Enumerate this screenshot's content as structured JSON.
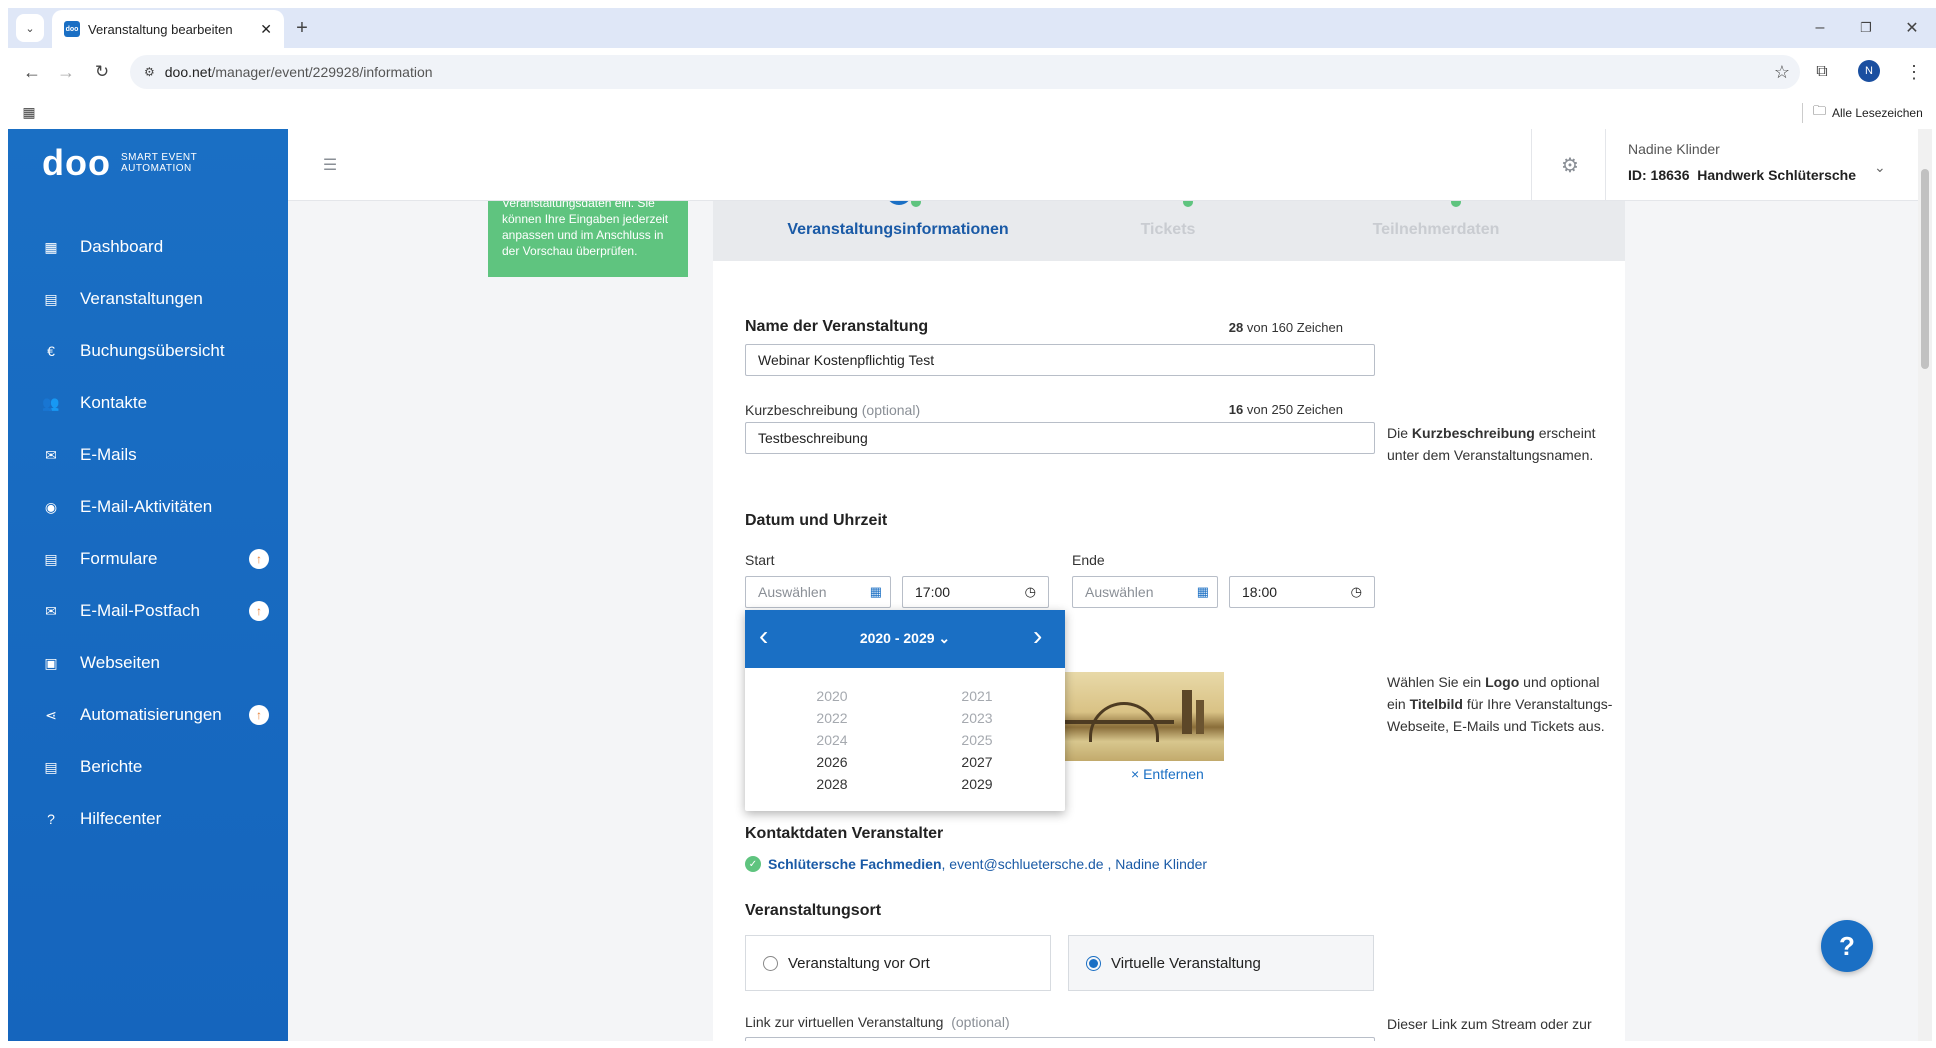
{
  "browser": {
    "tab_title": "Veranstaltung bearbeiten",
    "url_domain": "doo.net",
    "url_path": "/manager/event/229928/information",
    "bookmarks_label": "Alle Lesezeichen",
    "profile_initial": "N"
  },
  "brand": {
    "logo": "doo",
    "tagline_1": "SMART EVENT",
    "tagline_2": "AUTOMATION",
    "accent": "#1a6fc4"
  },
  "sidebar": {
    "items": [
      {
        "label": "Dashboard",
        "icon": "dashboard-icon"
      },
      {
        "label": "Veranstaltungen",
        "icon": "calendar-icon"
      },
      {
        "label": "Buchungsübersicht",
        "icon": "euro-icon"
      },
      {
        "label": "Kontakte",
        "icon": "people-icon"
      },
      {
        "label": "E-Mails",
        "icon": "mail-icon"
      },
      {
        "label": "E-Mail-Aktivitäten",
        "icon": "activity-icon"
      },
      {
        "label": "Formulare",
        "icon": "form-icon",
        "badge": "↑"
      },
      {
        "label": "E-Mail-Postfach",
        "icon": "inbox-icon",
        "badge": "↑"
      },
      {
        "label": "Webseiten",
        "icon": "website-icon"
      },
      {
        "label": "Automatisierungen",
        "icon": "share-icon",
        "badge": "↑"
      },
      {
        "label": "Berichte",
        "icon": "report-icon"
      },
      {
        "label": "Hilfecenter",
        "icon": "help-icon"
      }
    ]
  },
  "header": {
    "user_name": "Nadine Klinder",
    "org_id": "ID: 18636",
    "org_name": "Handwerk Schlütersche"
  },
  "hint": {
    "text": "Veranstaltungsdaten ein. Sie können Ihre Eingaben jederzeit anpassen und im Anschluss in der Vorschau überprüfen."
  },
  "steps": [
    {
      "label": "Veranstaltungsinformationen",
      "active": true
    },
    {
      "label": "Tickets",
      "active": false
    },
    {
      "label": "Teilnehmerdaten",
      "active": false
    }
  ],
  "form": {
    "name_label": "Name der Veranstaltung",
    "name_count": "28",
    "name_count_suffix": "von 160 Zeichen",
    "name_value": "Webinar Kostenpflichtig Test",
    "short_label": "Kurzbeschreibung",
    "short_optional": "(optional)",
    "short_count": "16",
    "short_count_suffix": "von 250 Zeichen",
    "short_value": "Testbeschreibung",
    "short_help_1": "Die ",
    "short_help_bold": "Kurzbeschreibung",
    "short_help_2": " erscheint unter dem Veranstaltungsnamen.",
    "datetime_heading": "Datum und Uhrzeit",
    "start_label": "Start",
    "end_label": "Ende",
    "date_placeholder": "Auswählen",
    "start_time": "17:00",
    "end_time": "18:00",
    "image_help_1": "Wählen Sie ein ",
    "image_help_b1": "Logo",
    "image_help_2": " und optional ein ",
    "image_help_b2": "Titelbild",
    "image_help_3": " für Ihre Veranstaltungs-Webseite, E-Mails und Tickets aus.",
    "remove_label": "× Entfernen",
    "contact_heading": "Kontaktdaten Veranstalter",
    "contact_company": "Schlütersche Fachmedien",
    "contact_rest": ", event@schluetersche.de , Nadine Klinder",
    "location_heading": "Veranstaltungsort",
    "location_onsite": "Veranstaltung vor Ort",
    "location_virtual": "Virtuelle Veranstaltung",
    "link_label": "Link zur virtuellen Veranstaltung",
    "link_optional": "(optional)",
    "link_help": "Dieser Link zum Stream oder zur"
  },
  "datepicker": {
    "range_label": "2020 - 2029",
    "years": [
      {
        "y": "2020",
        "enabled": false
      },
      {
        "y": "2021",
        "enabled": false
      },
      {
        "y": "2022",
        "enabled": false
      },
      {
        "y": "2023",
        "enabled": false
      },
      {
        "y": "2024",
        "enabled": false
      },
      {
        "y": "2025",
        "enabled": false
      },
      {
        "y": "2026",
        "enabled": true
      },
      {
        "y": "2027",
        "enabled": true
      },
      {
        "y": "2028",
        "enabled": true
      },
      {
        "y": "2029",
        "enabled": true
      }
    ]
  },
  "help_button": "?"
}
